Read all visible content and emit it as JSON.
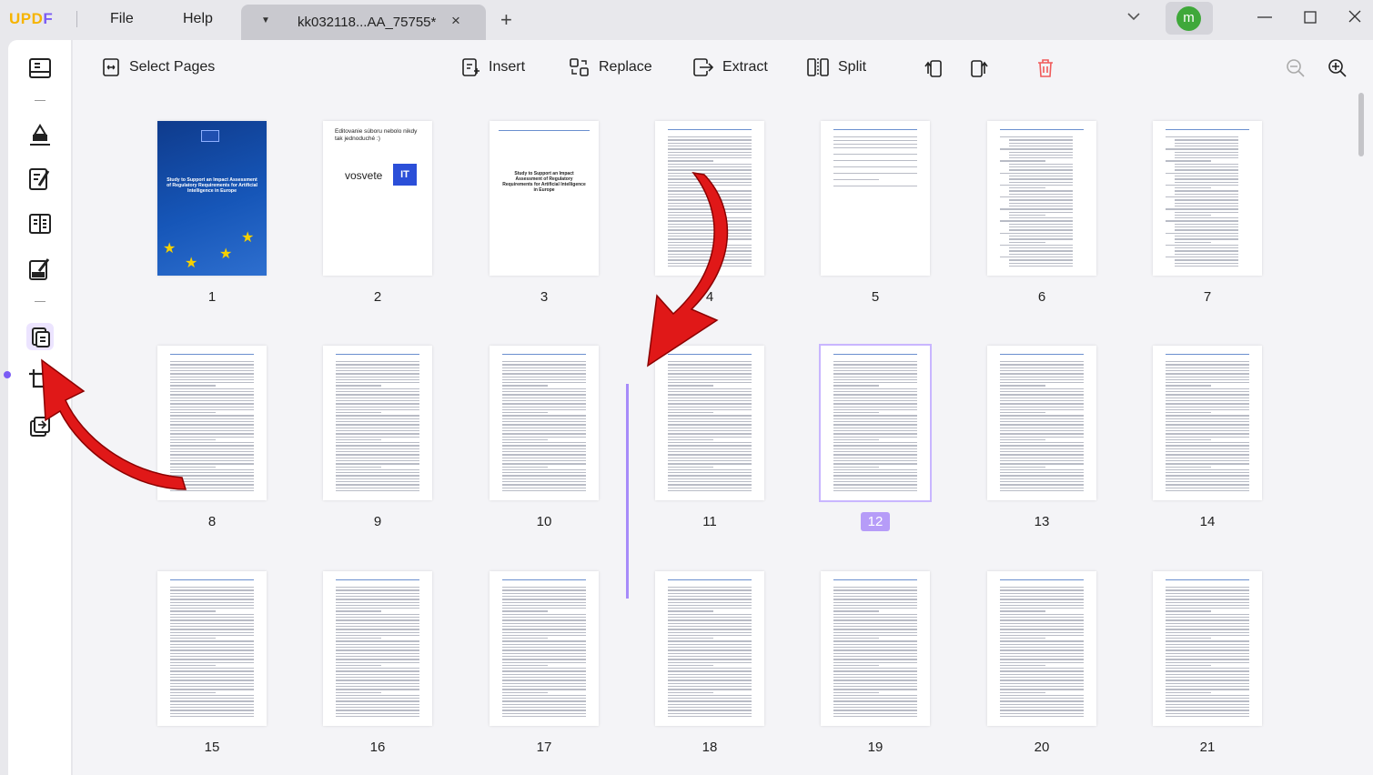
{
  "app": {
    "logo_part1": "UPD",
    "logo_part2": "F",
    "menu_file": "File",
    "menu_help": "Help",
    "tab_title": "kk032118...AA_75755*",
    "tab_close": "×",
    "new_tab": "+",
    "avatar_letter": "m",
    "accent": "#7b5cf5",
    "avatar_color": "#3fa83a"
  },
  "toolbar": {
    "select_pages": "Select Pages",
    "insert": "Insert",
    "replace": "Replace",
    "extract": "Extract",
    "split": "Split"
  },
  "pages": {
    "p1": "1",
    "p2": "2",
    "p3": "3",
    "p4": "4",
    "p5": "5",
    "p6": "6",
    "p7": "7",
    "p8": "8",
    "p9": "9",
    "p10": "10",
    "p11": "11",
    "p12": "12",
    "p13": "13",
    "p14": "14",
    "p15": "15",
    "p16": "16",
    "p17": "17",
    "p18": "18",
    "p19": "19",
    "p20": "20",
    "p21": "21",
    "selected_page": "12"
  },
  "thumb_text": {
    "cover_title": "Study to Support an Impact Assessment of Regulatory Requirements for Artificial Intelligence in Europe",
    "page2_line1": "Editovanie súboru nebolo nikdy tak jednoduché :)",
    "page2_brand": "vosvete",
    "page2_badge": "IT",
    "page3_title": "Study to Support an Impact Assessment of Regulatory Requirements for Artificial Intelligence in Europe"
  },
  "icons": {
    "sidebar": [
      "reader-icon",
      "highlighter-icon",
      "edit-pdf-icon",
      "form-icon",
      "sign-icon",
      "organize-pages-icon",
      "crop-icon",
      "batch-icon"
    ],
    "toolbar": [
      "select-pages-icon",
      "insert-icon",
      "replace-icon",
      "extract-icon",
      "split-icon",
      "rotate-left-icon",
      "rotate-right-icon",
      "delete-icon",
      "zoom-out-icon",
      "zoom-in-icon"
    ]
  }
}
